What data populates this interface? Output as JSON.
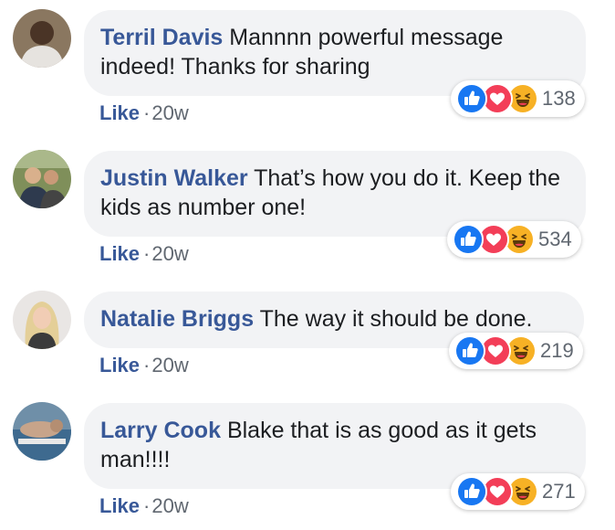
{
  "comments": [
    {
      "author": "Terril Davis",
      "text": "Mannnn powerful message indeed! Thanks for sharing",
      "like_label": "Like",
      "separator": "·",
      "time": "20w",
      "reaction_count": "138",
      "reactions": [
        "like-icon",
        "love-icon",
        "haha-icon"
      ]
    },
    {
      "author": "Justin Walker",
      "text": "That’s how you do it. Keep the kids as number one!",
      "like_label": "Like",
      "separator": "·",
      "time": "20w",
      "reaction_count": "534",
      "reactions": [
        "like-icon",
        "love-icon",
        "haha-icon"
      ]
    },
    {
      "author": "Natalie Briggs",
      "text": "The way it should be done.",
      "like_label": "Like",
      "separator": "·",
      "time": "20w",
      "reaction_count": "219",
      "reactions": [
        "like-icon",
        "love-icon",
        "haha-icon"
      ]
    },
    {
      "author": "Larry Cook",
      "text": "Blake that is as good as it gets man!!!!",
      "like_label": "Like",
      "separator": "·",
      "time": "20w",
      "reaction_count": "271",
      "reactions": [
        "like-icon",
        "love-icon",
        "haha-icon"
      ]
    }
  ],
  "colors": {
    "author": "#385898",
    "bubble_bg": "#f2f3f5",
    "meta": "#606770",
    "like_reaction": "#1877f2",
    "love_reaction": "#f33e58",
    "haha_reaction": "#f7b125"
  }
}
